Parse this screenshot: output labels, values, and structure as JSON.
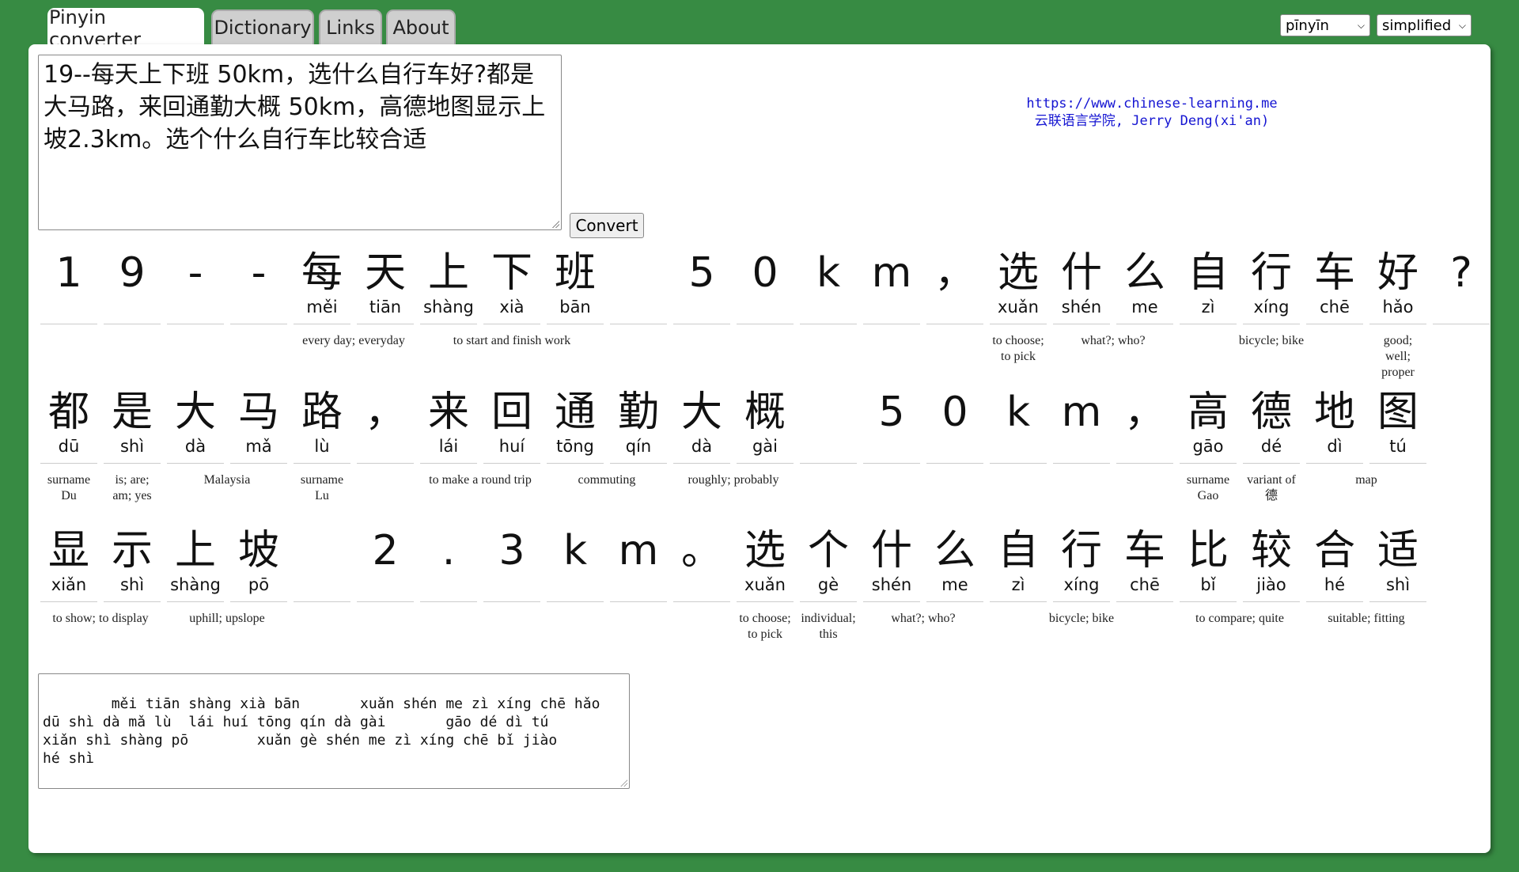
{
  "tabs": [
    {
      "label": "Pinyin converter",
      "active": true
    },
    {
      "label": "Dictionary",
      "active": false
    },
    {
      "label": "Links",
      "active": false
    },
    {
      "label": "About",
      "active": false
    }
  ],
  "selects": {
    "romanization": "pīnyīn",
    "script": "simplified"
  },
  "input_text": "19--每天上下班 50km，选什么自行车好?都是大马路，来回通勤大概 50km，高德地图显示上坡2.3km。选个什么自行车比较合适",
  "convert_label": "Convert",
  "site": {
    "url": "https://www.chinese-learning.me",
    "credit": "云联语言学院, Jerry Deng(xi'an)"
  },
  "rows": [
    {
      "chars": [
        {
          "hz": "1",
          "py": ""
        },
        {
          "hz": "9",
          "py": ""
        },
        {
          "hz": "-",
          "py": ""
        },
        {
          "hz": "-",
          "py": ""
        },
        {
          "hz": "每",
          "py": "měi"
        },
        {
          "hz": "天",
          "py": "tiān"
        },
        {
          "hz": "上",
          "py": "shàng"
        },
        {
          "hz": "下",
          "py": "xià"
        },
        {
          "hz": "班",
          "py": "bān"
        },
        {
          "hz": "",
          "py": ""
        },
        {
          "hz": "5",
          "py": ""
        },
        {
          "hz": "0",
          "py": ""
        },
        {
          "hz": "k",
          "py": ""
        },
        {
          "hz": "m",
          "py": ""
        },
        {
          "hz": "，",
          "py": ""
        },
        {
          "hz": "选",
          "py": "xuǎn"
        },
        {
          "hz": "什",
          "py": "shén"
        },
        {
          "hz": "么",
          "py": "me"
        },
        {
          "hz": "自",
          "py": "zì"
        },
        {
          "hz": "行",
          "py": "xíng"
        },
        {
          "hz": "车",
          "py": "chē"
        },
        {
          "hz": "好",
          "py": "hǎo"
        },
        {
          "hz": "?",
          "py": ""
        }
      ],
      "glosses": [
        {
          "start": 4,
          "span": 2,
          "text": "every day; everyday"
        },
        {
          "start": 6,
          "span": 3,
          "text": "to start and finish work"
        },
        {
          "start": 15,
          "span": 1,
          "text": "to choose; to pick"
        },
        {
          "start": 16,
          "span": 2,
          "text": "what?; who?"
        },
        {
          "start": 18,
          "span": 3,
          "text": "bicycle; bike"
        },
        {
          "start": 21,
          "span": 1,
          "text": "good; well; proper"
        }
      ]
    },
    {
      "chars": [
        {
          "hz": "都",
          "py": "dū"
        },
        {
          "hz": "是",
          "py": "shì"
        },
        {
          "hz": "大",
          "py": "dà"
        },
        {
          "hz": "马",
          "py": "mǎ"
        },
        {
          "hz": "路",
          "py": "lù"
        },
        {
          "hz": "，",
          "py": ""
        },
        {
          "hz": "来",
          "py": "lái"
        },
        {
          "hz": "回",
          "py": "huí"
        },
        {
          "hz": "通",
          "py": "tōng"
        },
        {
          "hz": "勤",
          "py": "qín"
        },
        {
          "hz": "大",
          "py": "dà"
        },
        {
          "hz": "概",
          "py": "gài"
        },
        {
          "hz": "",
          "py": ""
        },
        {
          "hz": "5",
          "py": ""
        },
        {
          "hz": "0",
          "py": ""
        },
        {
          "hz": "k",
          "py": ""
        },
        {
          "hz": "m",
          "py": ""
        },
        {
          "hz": "，",
          "py": ""
        },
        {
          "hz": "高",
          "py": "gāo"
        },
        {
          "hz": "德",
          "py": "dé"
        },
        {
          "hz": "地",
          "py": "dì"
        },
        {
          "hz": "图",
          "py": "tú"
        }
      ],
      "glosses": [
        {
          "start": 0,
          "span": 1,
          "text": "surname Du"
        },
        {
          "start": 1,
          "span": 1,
          "text": "is; are; am; yes"
        },
        {
          "start": 2,
          "span": 2,
          "text": "Malaysia"
        },
        {
          "start": 4,
          "span": 1,
          "text": "surname Lu"
        },
        {
          "start": 6,
          "span": 2,
          "text": "to make a round trip"
        },
        {
          "start": 8,
          "span": 2,
          "text": "commuting"
        },
        {
          "start": 10,
          "span": 2,
          "text": "roughly; probably"
        },
        {
          "start": 18,
          "span": 1,
          "text": "surname Gao"
        },
        {
          "start": 19,
          "span": 1,
          "text": "variant of 德"
        },
        {
          "start": 20,
          "span": 2,
          "text": "map"
        }
      ]
    },
    {
      "chars": [
        {
          "hz": "显",
          "py": "xiǎn"
        },
        {
          "hz": "示",
          "py": "shì"
        },
        {
          "hz": "上",
          "py": "shàng"
        },
        {
          "hz": "坡",
          "py": "pō"
        },
        {
          "hz": "",
          "py": ""
        },
        {
          "hz": "2",
          "py": ""
        },
        {
          "hz": ".",
          "py": ""
        },
        {
          "hz": "3",
          "py": ""
        },
        {
          "hz": "k",
          "py": ""
        },
        {
          "hz": "m",
          "py": ""
        },
        {
          "hz": "。",
          "py": ""
        },
        {
          "hz": "选",
          "py": "xuǎn"
        },
        {
          "hz": "个",
          "py": "gè"
        },
        {
          "hz": "什",
          "py": "shén"
        },
        {
          "hz": "么",
          "py": "me"
        },
        {
          "hz": "自",
          "py": "zì"
        },
        {
          "hz": "行",
          "py": "xíng"
        },
        {
          "hz": "车",
          "py": "chē"
        },
        {
          "hz": "比",
          "py": "bǐ"
        },
        {
          "hz": "较",
          "py": "jiào"
        },
        {
          "hz": "合",
          "py": "hé"
        },
        {
          "hz": "适",
          "py": "shì"
        }
      ],
      "glosses": [
        {
          "start": 0,
          "span": 2,
          "text": "to show; to display"
        },
        {
          "start": 2,
          "span": 2,
          "text": "uphill; upslope"
        },
        {
          "start": 11,
          "span": 1,
          "text": "to choose; to pick"
        },
        {
          "start": 12,
          "span": 1,
          "text": "individual; this"
        },
        {
          "start": 13,
          "span": 2,
          "text": "what?; who?"
        },
        {
          "start": 15,
          "span": 3,
          "text": "bicycle; bike"
        },
        {
          "start": 18,
          "span": 2,
          "text": "to compare; quite"
        },
        {
          "start": 20,
          "span": 2,
          "text": "suitable; fitting"
        }
      ]
    }
  ],
  "output_text": "    měi tiān shàng xià bān       xuǎn shén me zì xíng chē hǎo\ndū shì dà mǎ lù  lái huí tōng qín dà gài       gāo dé dì tú\nxiǎn shì shàng pō        xuǎn gè shén me zì xíng chē bǐ jiào\nhé shì"
}
